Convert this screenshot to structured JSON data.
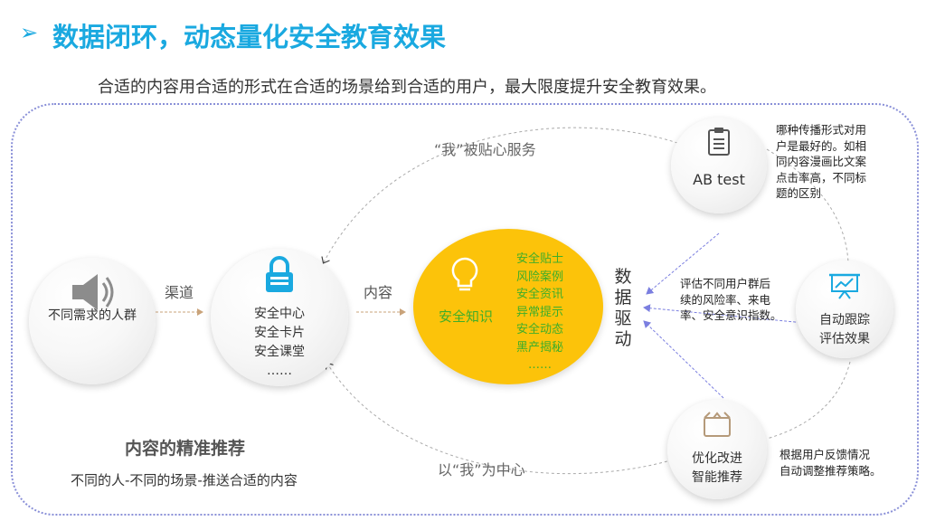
{
  "header": {
    "title": "数据闭环，动态量化安全教育效果",
    "subtitle": "合适的内容用合适的形式在合适的场景给到合适的用户，最大限度提升安全教育效果。"
  },
  "nodes": {
    "audience": {
      "label": "不同需求的人群",
      "icon": "speaker-icon"
    },
    "channels": {
      "lines": [
        "安全中心",
        "安全卡片",
        "安全课堂",
        "……"
      ],
      "icon": "lock-icon"
    },
    "knowledge": {
      "label": "安全知识",
      "icon": "lightbulb-icon",
      "items": [
        "安全贴士",
        "风险案例",
        "安全资讯",
        "异常提示",
        "安全动态",
        "黑产揭秘",
        "……"
      ]
    },
    "abtest": {
      "label": "AB test",
      "icon": "clipboard-icon"
    },
    "tracking": {
      "lines": [
        "自动跟踪",
        "评估效果"
      ],
      "icon": "presentation-chart-icon"
    },
    "optimize": {
      "lines": [
        "优化改进",
        "智能推荐"
      ],
      "icon": "box-icon"
    }
  },
  "labels": {
    "channel": "渠道",
    "content": "内容",
    "served": "“我”被贴心服务",
    "centered": "以“我”为中心",
    "data_driven": [
      "数",
      "据",
      "驱",
      "动"
    ]
  },
  "notes": {
    "abtest": [
      "哪种传播形式对用",
      "户是最好的。如相",
      "同内容漫画比文案",
      "点击率高，不同标",
      "题的区别"
    ],
    "tracking": [
      "评估不同用户群后",
      "续的风险率、来电",
      "率、安全意识指数。"
    ],
    "optimize": [
      "根据用户反馈情况",
      "自动调整推荐策略。"
    ]
  },
  "footer": {
    "heading": "内容的精准推荐",
    "text": "不同的人-不同的场景-推送合适的内容"
  },
  "colors": {
    "accent": "#1aa9e0",
    "gold": "#fcc30a",
    "green": "#3fae29",
    "dotted_border": "#8a90d8",
    "arrow": "#7b7fe0"
  }
}
